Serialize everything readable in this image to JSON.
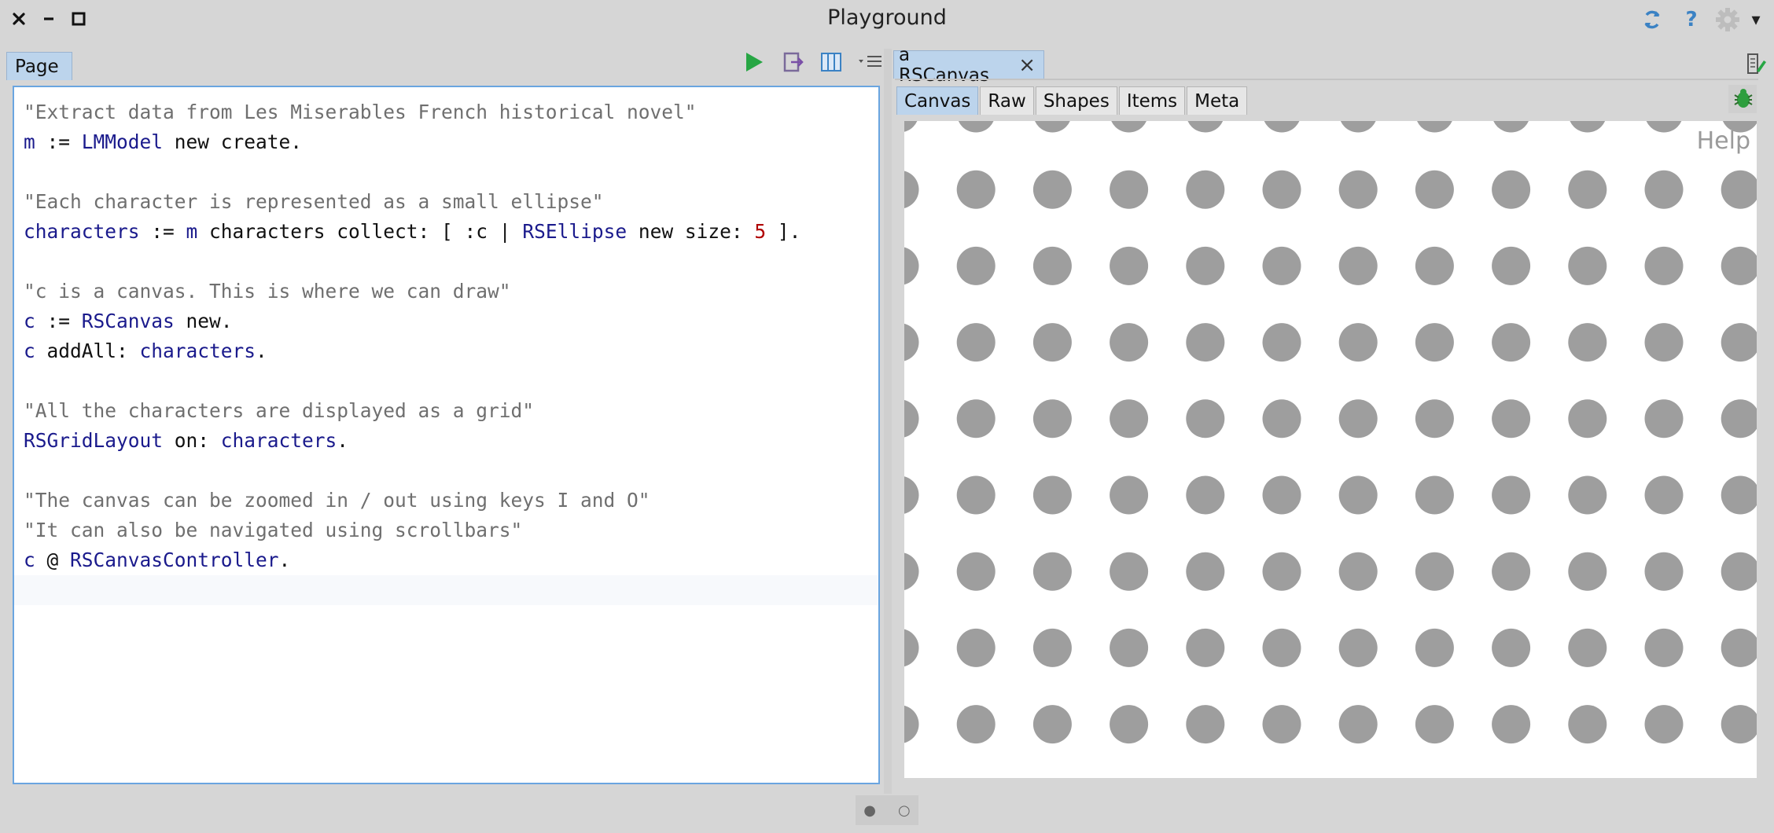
{
  "window": {
    "title": "Playground",
    "controls": {
      "close": "×",
      "minimize": "−",
      "maximize": "□"
    },
    "right_icons": [
      "sync-icon",
      "help-icon",
      "settings-icon"
    ],
    "help_glyph": "?",
    "settings_dropdown_glyph": "▾"
  },
  "left_pane": {
    "tab_label": "Page",
    "toolbar_icons": [
      "run-icon",
      "export-icon",
      "inspect-icon",
      "menu-icon"
    ],
    "code_lines": [
      {
        "type": "comment",
        "text": "\"Extract data from Les Miserables French historical novel\""
      },
      {
        "type": "code",
        "tokens": [
          {
            "t": "m",
            "k": "var"
          },
          {
            "t": " := ",
            "k": "msg"
          },
          {
            "t": "LMModel",
            "k": "class"
          },
          {
            "t": " new create.",
            "k": "msg"
          }
        ]
      },
      {
        "type": "blank",
        "text": ""
      },
      {
        "type": "comment",
        "text": "\"Each character is represented as a small ellipse\""
      },
      {
        "type": "code",
        "tokens": [
          {
            "t": "characters",
            "k": "var"
          },
          {
            "t": " := ",
            "k": "msg"
          },
          {
            "t": "m",
            "k": "var"
          },
          {
            "t": " characters collect: [ :c | ",
            "k": "msg"
          },
          {
            "t": "RSEllipse",
            "k": "class"
          },
          {
            "t": " new size: ",
            "k": "msg"
          },
          {
            "t": "5",
            "k": "num"
          },
          {
            "t": " ].",
            "k": "msg"
          }
        ]
      },
      {
        "type": "blank",
        "text": ""
      },
      {
        "type": "comment",
        "text": "\"c is a canvas. This is where we can draw\""
      },
      {
        "type": "code",
        "tokens": [
          {
            "t": "c",
            "k": "var"
          },
          {
            "t": " := ",
            "k": "msg"
          },
          {
            "t": "RSCanvas",
            "k": "class"
          },
          {
            "t": " new.",
            "k": "msg"
          }
        ]
      },
      {
        "type": "code",
        "tokens": [
          {
            "t": "c",
            "k": "var"
          },
          {
            "t": " addAll: ",
            "k": "msg"
          },
          {
            "t": "characters",
            "k": "var"
          },
          {
            "t": ".",
            "k": "msg"
          }
        ]
      },
      {
        "type": "blank",
        "text": ""
      },
      {
        "type": "comment",
        "text": "\"All the characters are displayed as a grid\""
      },
      {
        "type": "code",
        "tokens": [
          {
            "t": "RSGridLayout",
            "k": "class"
          },
          {
            "t": " on: ",
            "k": "msg"
          },
          {
            "t": "characters",
            "k": "var"
          },
          {
            "t": ".",
            "k": "msg"
          }
        ]
      },
      {
        "type": "blank",
        "text": ""
      },
      {
        "type": "comment",
        "text": "\"The canvas can be zoomed in / out using keys I and O\""
      },
      {
        "type": "comment",
        "text": "\"It can also be navigated using scrollbars\""
      },
      {
        "type": "code",
        "tokens": [
          {
            "t": "c",
            "k": "var"
          },
          {
            "t": " @ ",
            "k": "msg"
          },
          {
            "t": "RSCanvasController",
            "k": "class"
          },
          {
            "t": ".",
            "k": "msg"
          }
        ]
      },
      {
        "type": "current",
        "text": ""
      }
    ]
  },
  "right_pane": {
    "tab_label": "a RSCanvas",
    "tab_close": "×",
    "subtabs": [
      "Canvas",
      "Raw",
      "Shapes",
      "Items",
      "Meta"
    ],
    "active_subtab": "Canvas",
    "help_label": "Help",
    "dot_color": "#9e9e9e"
  },
  "pager": {
    "active": "●",
    "inactive": "○"
  }
}
